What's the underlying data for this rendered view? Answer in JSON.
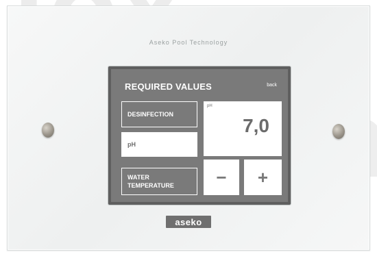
{
  "device": {
    "brand_top": "Aseko Pool Technology",
    "brand_bottom": "aseko"
  },
  "screen": {
    "title": "REQUIRED VALUES",
    "back_label": "back",
    "menu": [
      {
        "label": "DESINFECTION"
      },
      {
        "label": "pH"
      },
      {
        "label_line1": "WATER",
        "label_line2": "TEMPERATURE"
      }
    ],
    "value_panel": {
      "label": "pH",
      "value": "7,0"
    },
    "controls": {
      "minus_label": "−",
      "plus_label": "+"
    }
  },
  "colors": {
    "screen_bg": "#7a7a7a",
    "screen_border": "#5f5f5f",
    "panel_bg": "#ffffff",
    "text_dark": "#6b6b6b"
  }
}
